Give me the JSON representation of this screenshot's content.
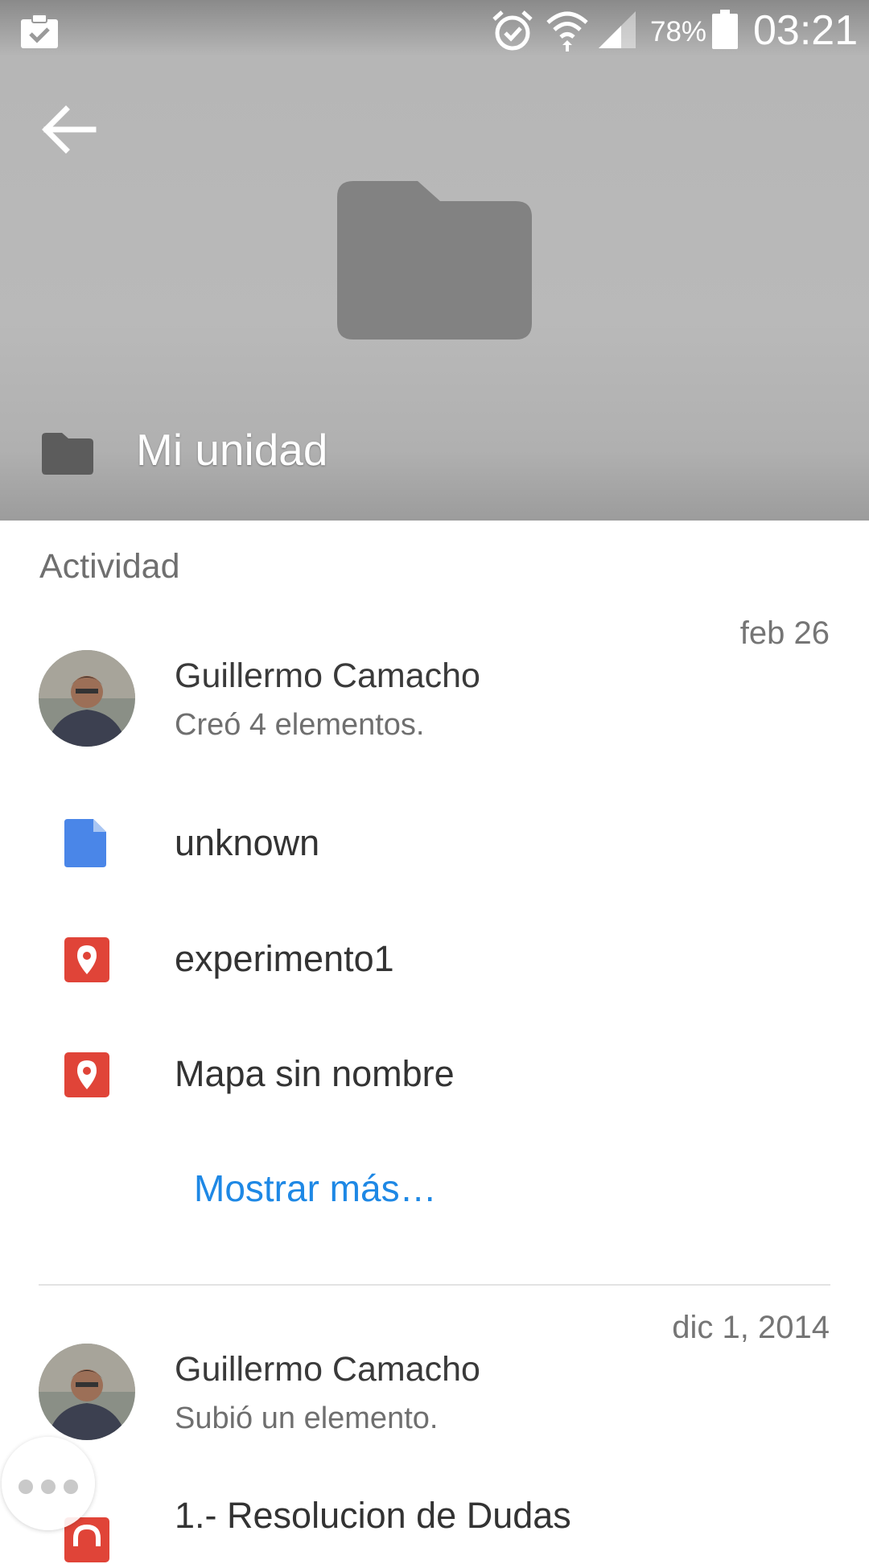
{
  "status_bar": {
    "battery": "78%",
    "time": "03:21",
    "icons": [
      "clipboard-check-icon",
      "alarm-icon",
      "wifi-icon",
      "signal-icon",
      "battery-icon"
    ]
  },
  "header": {
    "title": "Mi unidad",
    "back_icon": "arrow-back-icon",
    "folder_icon": "folder-icon"
  },
  "activity": {
    "section_label": "Actividad",
    "entries": [
      {
        "date": "feb 26",
        "user": "Guillermo Camacho",
        "action": "Creó 4 elementos.",
        "files": [
          {
            "name": "unknown",
            "icon": "document-icon",
            "color": "#4a86e8"
          },
          {
            "name": "experimento1",
            "icon": "map-pin-icon",
            "color": "#e04438"
          },
          {
            "name": "Mapa sin nombre",
            "icon": "map-pin-icon",
            "color": "#e04438"
          }
        ],
        "more_link": "Mostrar más…"
      },
      {
        "date": "dic 1, 2014",
        "user": "Guillermo Camacho",
        "action": "Subió un elemento.",
        "files": [
          {
            "name": "1.- Resolucion de Dudas",
            "icon": "audio-file-icon",
            "color": "#e04438"
          }
        ]
      }
    ]
  },
  "colors": {
    "link": "#1e88e5",
    "header_bg": "#b8b8b8",
    "folder_dark": "#808080"
  }
}
